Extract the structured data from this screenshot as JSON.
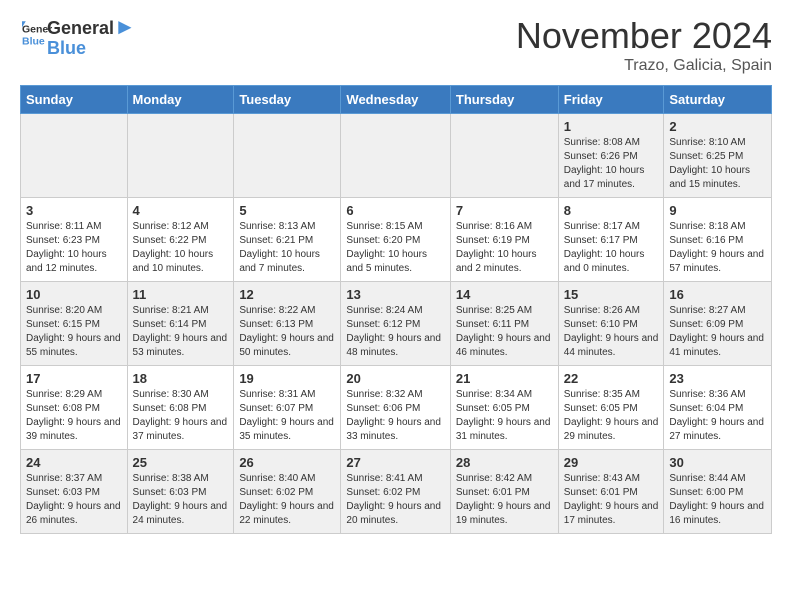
{
  "header": {
    "logo_line1": "General",
    "logo_line2": "Blue",
    "month_title": "November 2024",
    "location": "Trazo, Galicia, Spain"
  },
  "weekdays": [
    "Sunday",
    "Monday",
    "Tuesday",
    "Wednesday",
    "Thursday",
    "Friday",
    "Saturday"
  ],
  "weeks": [
    [
      {
        "day": "",
        "info": ""
      },
      {
        "day": "",
        "info": ""
      },
      {
        "day": "",
        "info": ""
      },
      {
        "day": "",
        "info": ""
      },
      {
        "day": "",
        "info": ""
      },
      {
        "day": "1",
        "info": "Sunrise: 8:08 AM\nSunset: 6:26 PM\nDaylight: 10 hours and 17 minutes."
      },
      {
        "day": "2",
        "info": "Sunrise: 8:10 AM\nSunset: 6:25 PM\nDaylight: 10 hours and 15 minutes."
      }
    ],
    [
      {
        "day": "3",
        "info": "Sunrise: 8:11 AM\nSunset: 6:23 PM\nDaylight: 10 hours and 12 minutes."
      },
      {
        "day": "4",
        "info": "Sunrise: 8:12 AM\nSunset: 6:22 PM\nDaylight: 10 hours and 10 minutes."
      },
      {
        "day": "5",
        "info": "Sunrise: 8:13 AM\nSunset: 6:21 PM\nDaylight: 10 hours and 7 minutes."
      },
      {
        "day": "6",
        "info": "Sunrise: 8:15 AM\nSunset: 6:20 PM\nDaylight: 10 hours and 5 minutes."
      },
      {
        "day": "7",
        "info": "Sunrise: 8:16 AM\nSunset: 6:19 PM\nDaylight: 10 hours and 2 minutes."
      },
      {
        "day": "8",
        "info": "Sunrise: 8:17 AM\nSunset: 6:17 PM\nDaylight: 10 hours and 0 minutes."
      },
      {
        "day": "9",
        "info": "Sunrise: 8:18 AM\nSunset: 6:16 PM\nDaylight: 9 hours and 57 minutes."
      }
    ],
    [
      {
        "day": "10",
        "info": "Sunrise: 8:20 AM\nSunset: 6:15 PM\nDaylight: 9 hours and 55 minutes."
      },
      {
        "day": "11",
        "info": "Sunrise: 8:21 AM\nSunset: 6:14 PM\nDaylight: 9 hours and 53 minutes."
      },
      {
        "day": "12",
        "info": "Sunrise: 8:22 AM\nSunset: 6:13 PM\nDaylight: 9 hours and 50 minutes."
      },
      {
        "day": "13",
        "info": "Sunrise: 8:24 AM\nSunset: 6:12 PM\nDaylight: 9 hours and 48 minutes."
      },
      {
        "day": "14",
        "info": "Sunrise: 8:25 AM\nSunset: 6:11 PM\nDaylight: 9 hours and 46 minutes."
      },
      {
        "day": "15",
        "info": "Sunrise: 8:26 AM\nSunset: 6:10 PM\nDaylight: 9 hours and 44 minutes."
      },
      {
        "day": "16",
        "info": "Sunrise: 8:27 AM\nSunset: 6:09 PM\nDaylight: 9 hours and 41 minutes."
      }
    ],
    [
      {
        "day": "17",
        "info": "Sunrise: 8:29 AM\nSunset: 6:08 PM\nDaylight: 9 hours and 39 minutes."
      },
      {
        "day": "18",
        "info": "Sunrise: 8:30 AM\nSunset: 6:08 PM\nDaylight: 9 hours and 37 minutes."
      },
      {
        "day": "19",
        "info": "Sunrise: 8:31 AM\nSunset: 6:07 PM\nDaylight: 9 hours and 35 minutes."
      },
      {
        "day": "20",
        "info": "Sunrise: 8:32 AM\nSunset: 6:06 PM\nDaylight: 9 hours and 33 minutes."
      },
      {
        "day": "21",
        "info": "Sunrise: 8:34 AM\nSunset: 6:05 PM\nDaylight: 9 hours and 31 minutes."
      },
      {
        "day": "22",
        "info": "Sunrise: 8:35 AM\nSunset: 6:05 PM\nDaylight: 9 hours and 29 minutes."
      },
      {
        "day": "23",
        "info": "Sunrise: 8:36 AM\nSunset: 6:04 PM\nDaylight: 9 hours and 27 minutes."
      }
    ],
    [
      {
        "day": "24",
        "info": "Sunrise: 8:37 AM\nSunset: 6:03 PM\nDaylight: 9 hours and 26 minutes."
      },
      {
        "day": "25",
        "info": "Sunrise: 8:38 AM\nSunset: 6:03 PM\nDaylight: 9 hours and 24 minutes."
      },
      {
        "day": "26",
        "info": "Sunrise: 8:40 AM\nSunset: 6:02 PM\nDaylight: 9 hours and 22 minutes."
      },
      {
        "day": "27",
        "info": "Sunrise: 8:41 AM\nSunset: 6:02 PM\nDaylight: 9 hours and 20 minutes."
      },
      {
        "day": "28",
        "info": "Sunrise: 8:42 AM\nSunset: 6:01 PM\nDaylight: 9 hours and 19 minutes."
      },
      {
        "day": "29",
        "info": "Sunrise: 8:43 AM\nSunset: 6:01 PM\nDaylight: 9 hours and 17 minutes."
      },
      {
        "day": "30",
        "info": "Sunrise: 8:44 AM\nSunset: 6:00 PM\nDaylight: 9 hours and 16 minutes."
      }
    ]
  ]
}
